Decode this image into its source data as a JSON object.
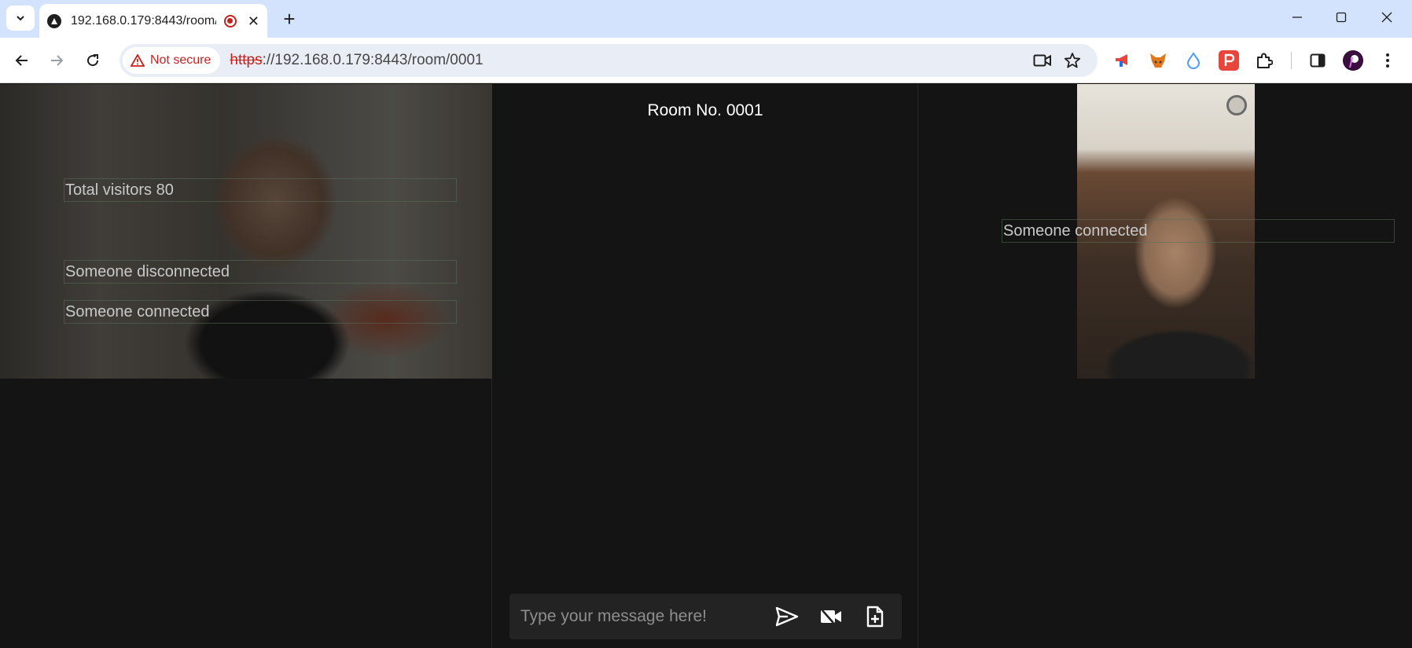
{
  "browser": {
    "tab": {
      "title": "192.168.0.179:8443/room/0001"
    },
    "address": {
      "security_label": "Not secure",
      "url_scheme": "https",
      "url_rest": "://192.168.0.179:8443/room/0001"
    }
  },
  "room": {
    "title": "Room No. 0001",
    "composer": {
      "placeholder": "Type your message here!"
    }
  },
  "local_panel": {
    "notices": [
      "Total visitors 80",
      "Someone disconnected",
      "Someone connected"
    ]
  },
  "remote_panel": {
    "notices": [
      "Someone connected"
    ]
  },
  "colors": {
    "page_bg": "#141414",
    "composer_bg": "#232323",
    "tabbar_bg": "#d3e3fd",
    "warning_red": "#c5221f"
  }
}
